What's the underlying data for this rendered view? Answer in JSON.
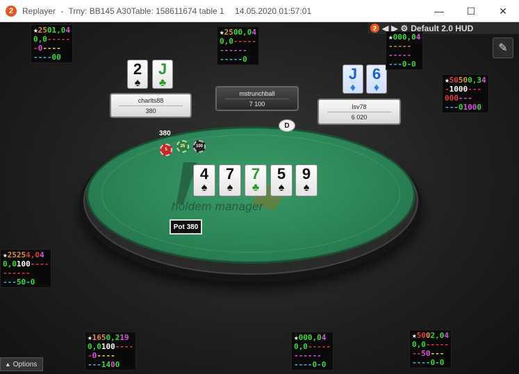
{
  "window": {
    "app_logo": "2",
    "title_app": "Replayer",
    "title_sep": "-",
    "title_table": "Trny: BB145 A30Table: 158611674 table 1",
    "title_time": "14.05.2020 01:57:01",
    "minimize_icon": "minimize-icon",
    "maximize_icon": "maximize-icon",
    "close_icon": "close-icon"
  },
  "hud_toolbar": {
    "logo": "2",
    "label": "Default 2.0 HUD"
  },
  "seats": {
    "charlts88": {
      "name": "charlts88",
      "stack": "380"
    },
    "mstrunchball": {
      "name": "mstrunchball",
      "stack": "7 100"
    },
    "lsv78": {
      "name": "lsv78",
      "stack": "6 020"
    }
  },
  "hole_cards": {
    "charlts88": [
      {
        "rank": "2",
        "suit": "♠",
        "color": "black"
      },
      {
        "rank": "J",
        "suit": "♣",
        "color": "green"
      }
    ],
    "lsv78": [
      {
        "rank": "J",
        "suit": "♦",
        "color": "blue"
      },
      {
        "rank": "6",
        "suit": "♦",
        "color": "blue"
      }
    ]
  },
  "board": [
    {
      "rank": "4",
      "suit": "♠",
      "color": "black"
    },
    {
      "rank": "7",
      "suit": "♠",
      "color": "black"
    },
    {
      "rank": "7",
      "suit": "♣",
      "color": "green"
    },
    {
      "rank": "5",
      "suit": "♠",
      "color": "black"
    },
    {
      "rank": "9",
      "suit": "♠",
      "color": "black"
    }
  ],
  "bet": {
    "amount": "380"
  },
  "chips": [
    {
      "label": "5",
      "color": "#c62828"
    },
    {
      "label": "25",
      "color": "#2e7d32"
    },
    {
      "label": "100",
      "color": "#222222"
    }
  ],
  "dealer_button": "D",
  "pot": {
    "label": "Pot 380"
  },
  "watermark": "holdem manager",
  "options": {
    "label": "Options",
    "icon": "chevron-up-icon"
  },
  "huds": {
    "top_left": {
      "rows": [
        [
          {
            "t": "★",
            "c": "white"
          },
          {
            "t": "25",
            "c": "orange"
          },
          {
            "t": " 0",
            "c": "green"
          },
          {
            "t": " 1,0",
            "c": "green"
          },
          {
            "t": " 4",
            "c": "magenta"
          }
        ],
        [
          {
            "t": "0,0",
            "c": "green"
          },
          {
            "t": "-----",
            "c": "red"
          }
        ],
        [
          {
            "t": "-",
            "c": "red"
          },
          {
            "t": "0",
            "c": "magenta"
          },
          {
            "t": "----",
            "c": "yellow"
          }
        ],
        [
          {
            "t": "----",
            "c": "cyan"
          },
          {
            "t": "00",
            "c": "green"
          }
        ]
      ]
    },
    "top_center": {
      "rows": [
        [
          {
            "t": "★",
            "c": "white"
          },
          {
            "t": "25",
            "c": "orange"
          },
          {
            "t": " 0",
            "c": "green"
          },
          {
            "t": " 0,0",
            "c": "green"
          },
          {
            "t": " 4",
            "c": "magenta"
          }
        ],
        [
          {
            "t": "0,0",
            "c": "green"
          },
          {
            "t": "-----",
            "c": "red"
          }
        ],
        [
          {
            "t": "------",
            "c": "magenta"
          }
        ],
        [
          {
            "t": "-----",
            "c": "cyan"
          },
          {
            "t": "0",
            "c": "green"
          }
        ]
      ]
    },
    "top_right": {
      "rows": [
        [
          {
            "t": "★",
            "c": "white"
          },
          {
            "t": "0",
            "c": "green"
          },
          {
            "t": "0",
            "c": "green"
          },
          {
            "t": "0,0",
            "c": "green"
          },
          {
            "t": "4",
            "c": "magenta"
          }
        ],
        [
          {
            "t": "-----",
            "c": "orange"
          }
        ],
        [
          {
            "t": "-----",
            "c": "magenta"
          }
        ],
        [
          {
            "t": "---",
            "c": "cyan"
          },
          {
            "t": "0",
            "c": "green"
          },
          {
            "t": "-",
            "c": "cyan"
          },
          {
            "t": "0",
            "c": "green"
          }
        ]
      ]
    },
    "right": {
      "rows": [
        [
          {
            "t": "★",
            "c": "white"
          },
          {
            "t": "50",
            "c": "red"
          },
          {
            "t": " 50",
            "c": "orange"
          },
          {
            "t": " 0,3",
            "c": "green"
          },
          {
            "t": " 4",
            "c": "magenta"
          }
        ],
        [
          {
            "t": "-",
            "c": "red"
          },
          {
            "t": "100",
            "c": "white"
          },
          {
            "t": " 0",
            "c": "white"
          },
          {
            "t": "---",
            "c": "red"
          }
        ],
        [
          {
            "t": "000",
            "c": "red"
          },
          {
            "t": "---",
            "c": "magenta"
          }
        ],
        [
          {
            "t": "---",
            "c": "cyan"
          },
          {
            "t": "0",
            "c": "green"
          },
          {
            "t": "100",
            "c": "magenta"
          },
          {
            "t": " 0",
            "c": "green"
          }
        ]
      ]
    },
    "left": {
      "rows": [
        [
          {
            "t": "★",
            "c": "white"
          },
          {
            "t": "25",
            "c": "orange"
          },
          {
            "t": " 25",
            "c": "orange"
          },
          {
            "t": " 4,0",
            "c": "red"
          },
          {
            "t": " 4",
            "c": "magenta"
          }
        ],
        [
          {
            "t": "0,0",
            "c": "green"
          },
          {
            "t": " 100",
            "c": "white"
          },
          {
            "t": " ----",
            "c": "red"
          }
        ],
        [
          {
            "t": "------",
            "c": "red"
          }
        ],
        [
          {
            "t": "---",
            "c": "cyan"
          },
          {
            "t": "50",
            "c": "green"
          },
          {
            "t": " -",
            "c": "cyan"
          },
          {
            "t": " 0",
            "c": "green"
          }
        ]
      ]
    },
    "bottom_left": {
      "rows": [
        [
          {
            "t": "★",
            "c": "white"
          },
          {
            "t": "16",
            "c": "orange"
          },
          {
            "t": " 5",
            "c": "orange"
          },
          {
            "t": " 0,2",
            "c": "green"
          },
          {
            "t": " 19",
            "c": "magenta"
          }
        ],
        [
          {
            "t": "0,0",
            "c": "green"
          },
          {
            "t": " 100",
            "c": "white"
          },
          {
            "t": " ----",
            "c": "red"
          }
        ],
        [
          {
            "t": "-",
            "c": "red"
          },
          {
            "t": "0",
            "c": "magenta"
          },
          {
            "t": "----",
            "c": "yellow"
          }
        ],
        [
          {
            "t": "---",
            "c": "cyan"
          },
          {
            "t": "14",
            "c": "green"
          },
          {
            "t": " 0",
            "c": "magenta"
          },
          {
            "t": "0",
            "c": "green"
          }
        ]
      ]
    },
    "bottom_center": {
      "rows": [
        [
          {
            "t": "★",
            "c": "white"
          },
          {
            "t": "0",
            "c": "green"
          },
          {
            "t": " 0",
            "c": "green"
          },
          {
            "t": " 0,0",
            "c": "green"
          },
          {
            "t": " 4",
            "c": "magenta"
          }
        ],
        [
          {
            "t": "0,0",
            "c": "green"
          },
          {
            "t": "-----",
            "c": "red"
          }
        ],
        [
          {
            "t": "------",
            "c": "magenta"
          }
        ],
        [
          {
            "t": "----",
            "c": "cyan"
          },
          {
            "t": "0",
            "c": "green"
          },
          {
            "t": "-",
            "c": "cyan"
          },
          {
            "t": "0",
            "c": "green"
          }
        ]
      ]
    },
    "bottom_right": {
      "rows": [
        [
          {
            "t": "★",
            "c": "white"
          },
          {
            "t": "50",
            "c": "red"
          },
          {
            "t": " 0",
            "c": "orange"
          },
          {
            "t": " 2,0",
            "c": "green"
          },
          {
            "t": " 4",
            "c": "magenta"
          }
        ],
        [
          {
            "t": "0,0",
            "c": "green"
          },
          {
            "t": "-----",
            "c": "red"
          }
        ],
        [
          {
            "t": "--",
            "c": "red"
          },
          {
            "t": "50",
            "c": "magenta"
          },
          {
            "t": "---",
            "c": "yellow"
          }
        ],
        [
          {
            "t": "----",
            "c": "cyan"
          },
          {
            "t": "0",
            "c": "green"
          },
          {
            "t": "-",
            "c": "cyan"
          },
          {
            "t": "0",
            "c": "green"
          }
        ]
      ]
    }
  }
}
